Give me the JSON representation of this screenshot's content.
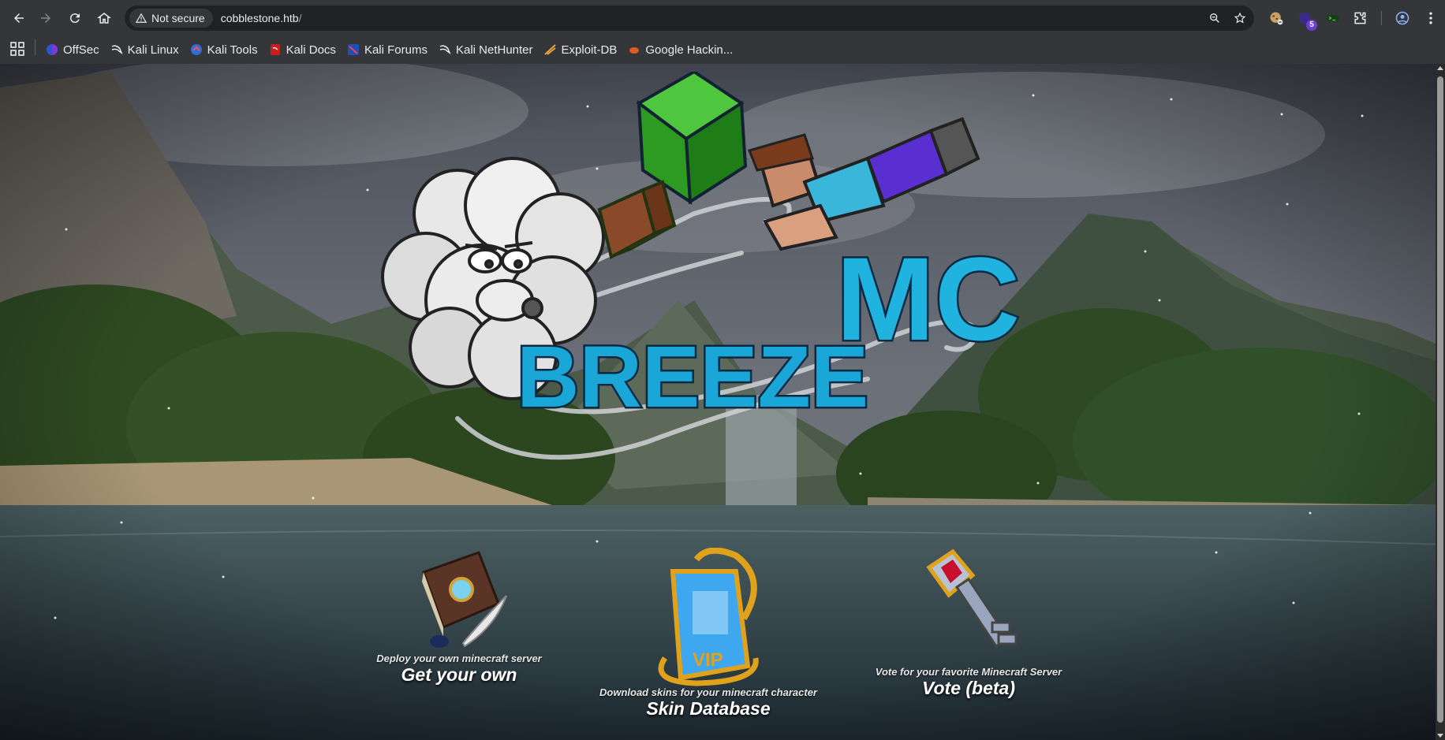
{
  "browser": {
    "security_label": "Not secure",
    "url_host": "cobblestone.htb",
    "url_path": "/",
    "extension_badge": "5"
  },
  "bookmarks": [
    {
      "label": "OffSec",
      "icon": "offsec-icon"
    },
    {
      "label": "Kali Linux",
      "icon": "kali-dragon-icon"
    },
    {
      "label": "Kali Tools",
      "icon": "kali-tools-icon"
    },
    {
      "label": "Kali Docs",
      "icon": "kali-docs-icon"
    },
    {
      "label": "Kali Forums",
      "icon": "kali-forums-icon"
    },
    {
      "label": "Kali NetHunter",
      "icon": "kali-dragon-icon"
    },
    {
      "label": "Exploit-DB",
      "icon": "exploit-db-icon"
    },
    {
      "label": "Google Hackin...",
      "icon": "ghdb-icon"
    }
  ],
  "hero": {
    "logo_text": "BREEZEMC"
  },
  "cards": [
    {
      "subtitle": "Deploy your own minecraft server",
      "title": "Get your own",
      "icon": "book-quill-icon"
    },
    {
      "subtitle": "Download skins for your minecraft character",
      "title": "Skin Database",
      "icon": "vip-card-icon"
    },
    {
      "subtitle": "Vote for your favorite Minecraft Server",
      "title": "Vote (beta)",
      "icon": "key-icon"
    }
  ],
  "colors": {
    "chrome_bg": "#35363a",
    "omnibox_bg": "#202124",
    "logo_blue": "#1aa6d6",
    "hammer_green": "#2e9a28"
  }
}
